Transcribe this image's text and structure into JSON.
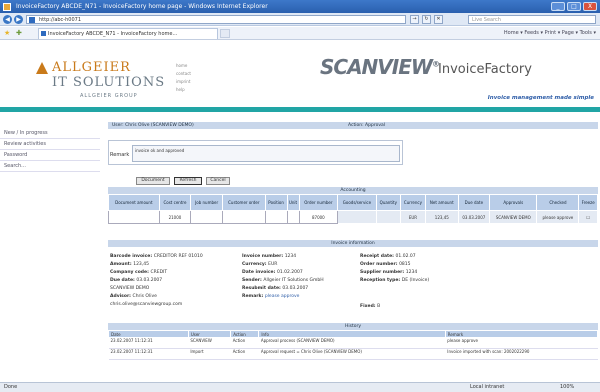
{
  "window": {
    "title": "InvoiceFactory ABCDE_N71 - InvoiceFactory home page - Windows Internet Explorer",
    "min": "_",
    "max": "□",
    "close": "X"
  },
  "browser": {
    "address": "http://abc-h0071",
    "search_placeholder": "Live Search",
    "tab_label": "InvoiceFactory ABCDE_N71 - InvoiceFactory home...",
    "commands": "Home ▾  Feeds ▾  Print ▾  Page ▾  Tools ▾"
  },
  "brand": {
    "company_line1": "ALLGEIER",
    "company_line2": "IT SOLUTIONS",
    "company_line3": "ALLGEIER GROUP",
    "top_links": [
      "home",
      "contact",
      "imprint",
      "help"
    ],
    "scan_logo": "SCANVIEW",
    "registered": "®",
    "product": "InvoiceFactory",
    "tagline": "Invoice management made simple"
  },
  "sidebar": {
    "items": [
      "New / In progress",
      "Review activities",
      "Password",
      "Search..."
    ]
  },
  "approval": {
    "user_label": "User: Chris Olive (SCANVIEW DEMO)",
    "section_label": "Action: Approval",
    "remark_label": "Remark",
    "remark_value": "invoice ok and approved",
    "buttons": [
      "Document",
      "Refresh",
      "Cancel"
    ]
  },
  "accounting": {
    "title": "Accounting",
    "columns": [
      "Document amount",
      "Cost centre",
      "Job number",
      "Customer order",
      "Position",
      "Unit",
      "Order number",
      "Goods/service",
      "Quantity",
      "Currency",
      "Net amount",
      "Due date",
      "Approvals",
      "Checked",
      "Freeze"
    ],
    "row": [
      "",
      "21000",
      "",
      "",
      "",
      "",
      "87000",
      "",
      "",
      "EUR",
      "123,45",
      "03.03.2007",
      "SCANVIEW DEMO",
      "please approve",
      "☐"
    ]
  },
  "invoice_info": {
    "title": "Invoice information",
    "fields": [
      {
        "label": "Barcode invoice:",
        "value": "CREDITOR REF 01010"
      },
      {
        "label": "Amount:",
        "value": "123,45"
      },
      {
        "label": "Company code:",
        "value": "CREDIT"
      },
      {
        "label": "Due date:",
        "value": "03.03.2007"
      },
      {
        "label": "Advisor:",
        "value": "Chris Olive"
      },
      {
        "label": "Invoice number:",
        "value": "1234"
      },
      {
        "label": "Currency:",
        "value": "EUR"
      },
      {
        "label": "Date invoice:",
        "value": "01.02.2007"
      },
      {
        "label": "Remark:",
        "value": "please approve"
      },
      {
        "label": "Receipt date:",
        "value": "01.02.07"
      },
      {
        "label": "Order number:",
        "value": "0815"
      },
      {
        "label": "Supplier number:",
        "value": "1234"
      },
      {
        "label": "Reception type:",
        "value": "DE (Invoice)"
      },
      {
        "label": "Fixed:",
        "value": "B"
      },
      {
        "label": "",
        "value": "SCANVIEW DEMO"
      },
      {
        "label": "",
        "value": "chris.olive@scanviewgroup.com"
      },
      {
        "label": "Sender:",
        "value": "Allgeier IT Solutions GmbH"
      },
      {
        "label": "Resubmit date:",
        "value": "03.03.2007"
      }
    ]
  },
  "history": {
    "title": "History",
    "columns": [
      "Date",
      "User",
      "Action",
      "Info",
      "Remark"
    ],
    "rows": [
      [
        "23.02.2007 11:12:31",
        "SCANVIEW",
        "Action",
        "Approval process (SCANVIEW DEMO)",
        "please approve"
      ],
      [
        "23.02.2007 11:12:31",
        "Import",
        "Action",
        "Approval request = Chris Olive (SCANVIEW DEMO)",
        "Invoice imported with scan: 2002022290"
      ]
    ]
  },
  "status": {
    "left": "Done",
    "zone": "Local intranet",
    "zoom": "100%"
  }
}
